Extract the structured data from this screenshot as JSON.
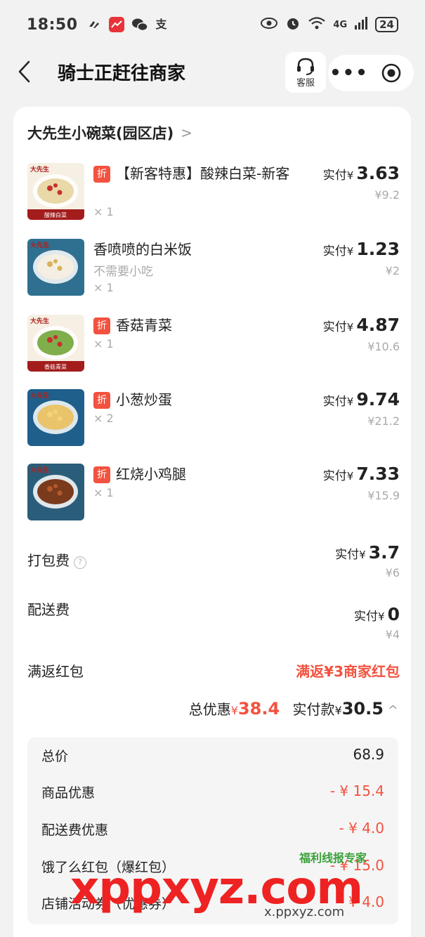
{
  "status_bar": {
    "time": "18:50",
    "network": "4G",
    "battery": "24"
  },
  "header": {
    "title": "骑士正赶往商家",
    "service_label": "客服",
    "more_label": "•••"
  },
  "shop": {
    "name": "大先生小碗菜(园区店)",
    "chevron": ">"
  },
  "pay_label": "实付",
  "currency": "¥",
  "discount_tag": "折",
  "items": [
    {
      "name": "【新客特惠】酸辣白菜-新客",
      "discount": true,
      "note": "",
      "qty": "× 1",
      "paid": "3.63",
      "original": "¥9.2",
      "thumb_caption": "酸辣白菜",
      "thumb_logo": "大先生"
    },
    {
      "name": "香喷喷的白米饭",
      "discount": false,
      "note": "不需要小吃",
      "qty": "× 1",
      "paid": "1.23",
      "original": "¥2",
      "thumb_caption": "",
      "thumb_logo": "大先生"
    },
    {
      "name": "香菇青菜",
      "discount": true,
      "note": "",
      "qty": "× 1",
      "paid": "4.87",
      "original": "¥10.6",
      "thumb_caption": "香菇青菜",
      "thumb_logo": "大先生"
    },
    {
      "name": "小葱炒蛋",
      "discount": true,
      "note": "",
      "qty": "× 2",
      "paid": "9.74",
      "original": "¥21.2",
      "thumb_caption": "",
      "thumb_logo": "大先生"
    },
    {
      "name": "红烧小鸡腿",
      "discount": true,
      "note": "",
      "qty": "× 1",
      "paid": "7.33",
      "original": "¥15.9",
      "thumb_caption": "",
      "thumb_logo": "大先生"
    }
  ],
  "packing_fee": {
    "label": "打包费",
    "help": "?",
    "paid": "3.7",
    "original": "¥6"
  },
  "delivery_fee": {
    "label": "配送费",
    "paid": "0",
    "original": "¥4"
  },
  "promo": {
    "label": "满返红包",
    "value": "满返¥3商家红包"
  },
  "summary": {
    "discount_label": "总优惠",
    "discount_value": "38.4",
    "paid_label": "实付款",
    "paid_value": "30.5",
    "chevron": "^"
  },
  "breakdown": [
    {
      "label": "总价",
      "value": "68.9",
      "red": false
    },
    {
      "label": "商品优惠",
      "value": "- ¥ 15.4",
      "red": true
    },
    {
      "label": "配送费优惠",
      "value": "- ¥ 4.0",
      "red": true
    },
    {
      "label": "饿了么红包（爆红包）",
      "value": "- ¥ 15.0",
      "red": true
    },
    {
      "label": "店铺活动券（优惠券）",
      "value": "- ¥ 4.0",
      "red": true
    }
  ],
  "watermark": {
    "big": "xppxyz.com",
    "badge": "福利线报专家",
    "small": "x.ppxyz.com"
  },
  "colors": {
    "accent": "#f2523f",
    "muted": "#aaaaaa"
  }
}
